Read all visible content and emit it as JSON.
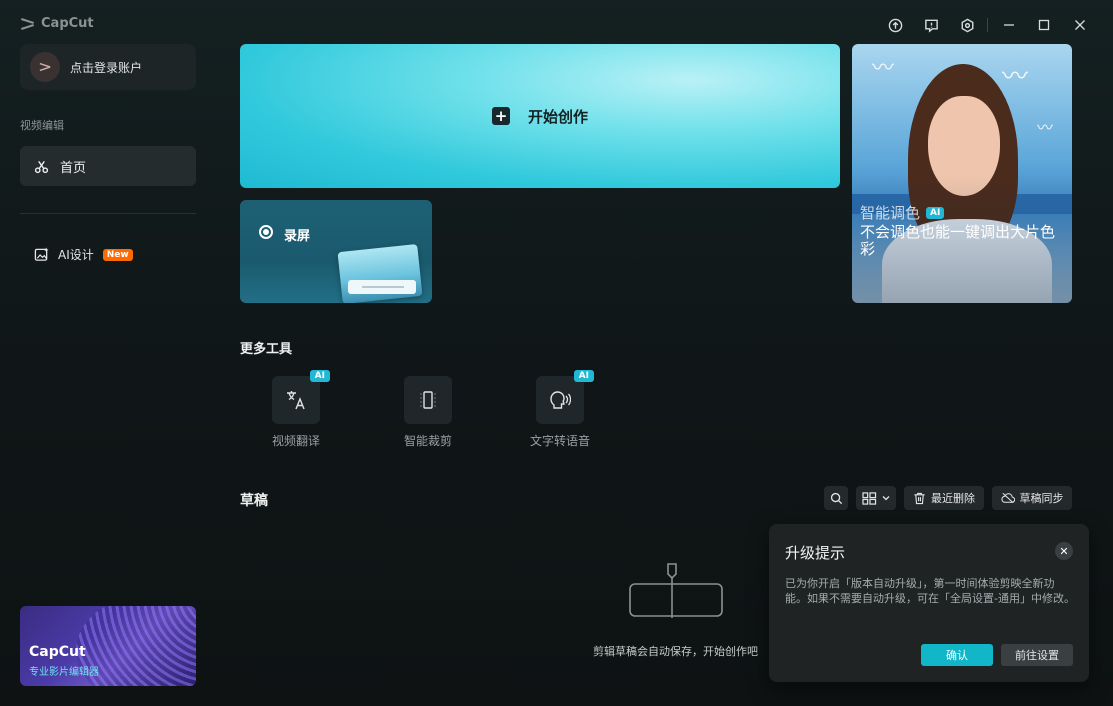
{
  "app": {
    "name": "CapCut"
  },
  "titlebar": {
    "icons": [
      "upload-icon",
      "feedback-icon",
      "settings-icon",
      "minimize-icon",
      "maximize-icon",
      "close-icon"
    ]
  },
  "sidebar": {
    "login_label": "点击登录账户",
    "section_label": "视频编辑",
    "home_label": "首页",
    "ai_design_label": "AI设计",
    "ai_design_badge": "New",
    "promo": {
      "title": "CapCut",
      "subtitle": "专业影片编辑器"
    }
  },
  "main": {
    "start_label": "开始创作",
    "record_label": "录屏",
    "feature_card": {
      "title": "智能调色",
      "badge": "AI",
      "subtitle": "不会调色也能一键调出大片色彩"
    },
    "more_tools_title": "更多工具",
    "tools": [
      {
        "label": "视频翻译",
        "badge": "AI",
        "icon": "translate-icon"
      },
      {
        "label": "智能裁剪",
        "badge": "",
        "icon": "crop-icon"
      },
      {
        "label": "文字转语音",
        "badge": "AI",
        "icon": "text-to-speech-icon"
      }
    ],
    "drafts": {
      "title": "草稿",
      "recent_delete_label": "最近删除",
      "sync_label": "草稿同步",
      "empty_text": "剪辑草稿会自动保存，开始创作吧"
    }
  },
  "upgrade_popup": {
    "title": "升级提示",
    "body": "已为你开启「版本自动升级」，第一时间体验剪映全新功能。如果不需要自动升级，可在「全局设置-通用」中修改。",
    "confirm_label": "确认",
    "settings_label": "前往设置"
  },
  "colors": {
    "accent": "#12b6c9",
    "new_badge": "#ff6a00",
    "ai_badge": "#21b8d6"
  }
}
